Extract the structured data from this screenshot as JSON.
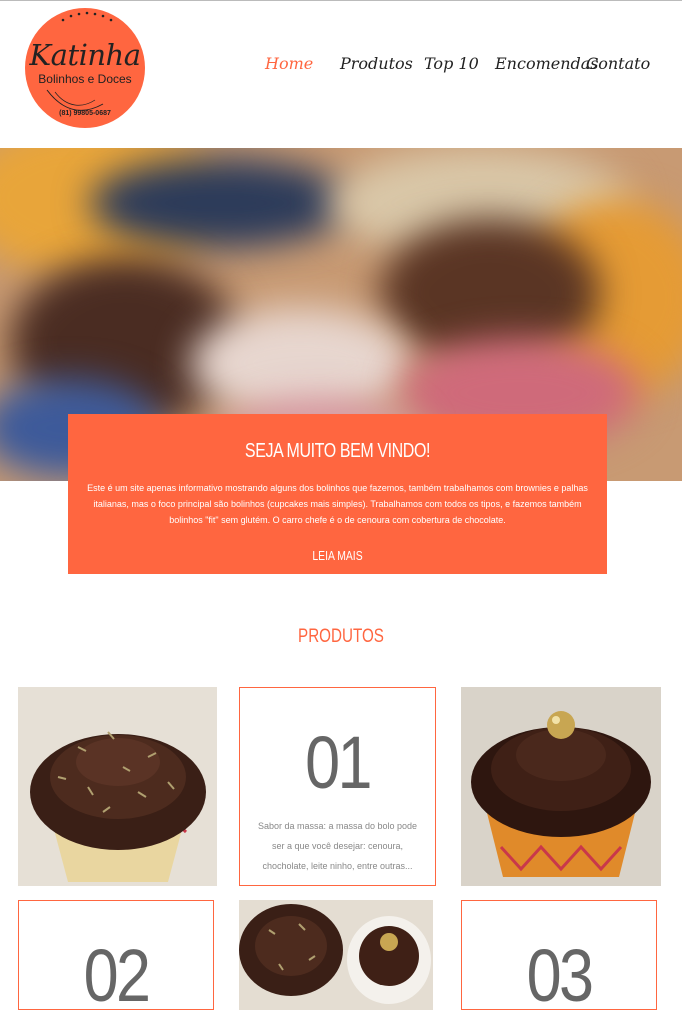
{
  "header": {
    "logo": {
      "name": "Katinha",
      "subtitle": "Bolinhos e Doces",
      "phone": "(81) 99805-0687"
    },
    "nav": [
      {
        "label": "Home",
        "active": true
      },
      {
        "label": "Produtos",
        "active": false
      },
      {
        "label": "Top 10",
        "active": false
      },
      {
        "label": "Encomendas",
        "active": false
      },
      {
        "label": "Contato",
        "active": false
      }
    ]
  },
  "welcome": {
    "title": "SEJA MUITO BEM VINDO!",
    "text": "Este é um site apenas informativo mostrando alguns dos bolinhos que fazemos, também trabalhamos com brownies e palhas italianas, mas o foco principal são bolinhos (cupcakes mais simples). Trabalhamos com todos os tipos, e fazemos também bolinhos \"fit\" sem glutém. O carro chefe é o de cenoura com cobertura de chocolate.",
    "read_more": "LEIA MAIS"
  },
  "products": {
    "title": "PRODUTOS",
    "items": [
      {
        "number": "01",
        "description": "Sabor da massa: a massa do bolo pode ser a que você desejar: cenoura, chocholate, leite ninho, entre outras..."
      },
      {
        "number": "02",
        "description": ""
      },
      {
        "number": "03",
        "description": ""
      }
    ]
  },
  "colors": {
    "accent": "#ff6640",
    "text": "#222222",
    "muted": "#888888"
  }
}
